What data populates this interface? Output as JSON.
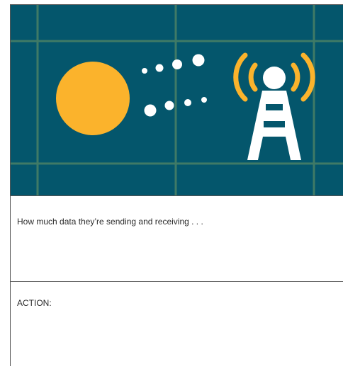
{
  "colors": {
    "background": "#04566c",
    "grid": "#3f7a66",
    "sun": "#fbb32c",
    "signal": "#fbb32c",
    "dots": "#ffffff",
    "tower": "#ffffff"
  },
  "icons": [
    "sun-icon",
    "data-dots-icon",
    "broadcast-signal-icon",
    "cell-tower-icon"
  ],
  "prompt_text": "How much data they’re sending and receiving . . .",
  "action_label": "ACTION:"
}
